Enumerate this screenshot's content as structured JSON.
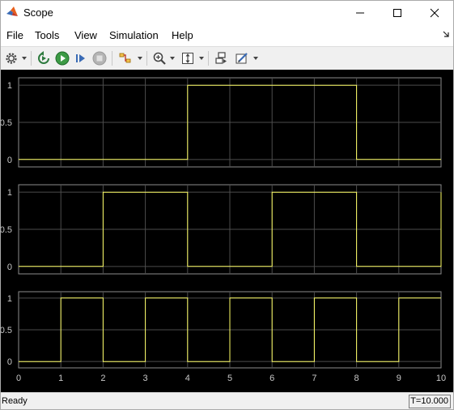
{
  "window": {
    "title": "Scope"
  },
  "menu": [
    "File",
    "Tools",
    "View",
    "Simulation",
    "Help"
  ],
  "toolbar": {
    "icons": [
      "settings-icon",
      "step-back-icon",
      "run-icon",
      "step-forward-icon",
      "stop-icon",
      "signal-selector-icon",
      "zoom-icon",
      "autoscale-icon",
      "highlight-block-icon",
      "style-icon"
    ]
  },
  "status": {
    "text": "Ready",
    "time": "T=10.000"
  },
  "colors": {
    "plot_bg": "#000000",
    "axes_bg": "#000000",
    "grid": "#4d4d4d",
    "trace": "#ffff66",
    "tick_text": "#c8c8c8"
  },
  "chart_data": [
    {
      "type": "line",
      "x": [
        0,
        4,
        4,
        8,
        8,
        10
      ],
      "y": [
        0,
        0,
        1,
        1,
        0,
        0
      ],
      "xlim": [
        0,
        10
      ],
      "ylim": [
        -0.1,
        1.1
      ],
      "yticks": [
        "1",
        "0.5",
        "0"
      ],
      "grid": true
    },
    {
      "type": "line",
      "x": [
        0,
        2,
        2,
        4,
        4,
        6,
        6,
        8,
        8,
        10,
        10
      ],
      "y": [
        0,
        0,
        1,
        1,
        0,
        0,
        1,
        1,
        0,
        0,
        1
      ],
      "xlim": [
        0,
        10
      ],
      "ylim": [
        -0.1,
        1.1
      ],
      "yticks": [
        "1",
        "0.5",
        "0"
      ],
      "grid": true
    },
    {
      "type": "line",
      "x": [
        0,
        1,
        1,
        2,
        2,
        3,
        3,
        4,
        4,
        5,
        5,
        6,
        6,
        7,
        7,
        8,
        8,
        9,
        9,
        10
      ],
      "y": [
        0,
        0,
        1,
        1,
        0,
        0,
        1,
        1,
        0,
        0,
        1,
        1,
        0,
        0,
        1,
        1,
        0,
        0,
        1,
        1
      ],
      "xlim": [
        0,
        10
      ],
      "ylim": [
        -0.1,
        1.1
      ],
      "yticks": [
        "1",
        "0.5",
        "0"
      ],
      "xticks": [
        "0",
        "1",
        "2",
        "3",
        "4",
        "5",
        "6",
        "7",
        "8",
        "9",
        "10"
      ],
      "grid": true
    }
  ]
}
